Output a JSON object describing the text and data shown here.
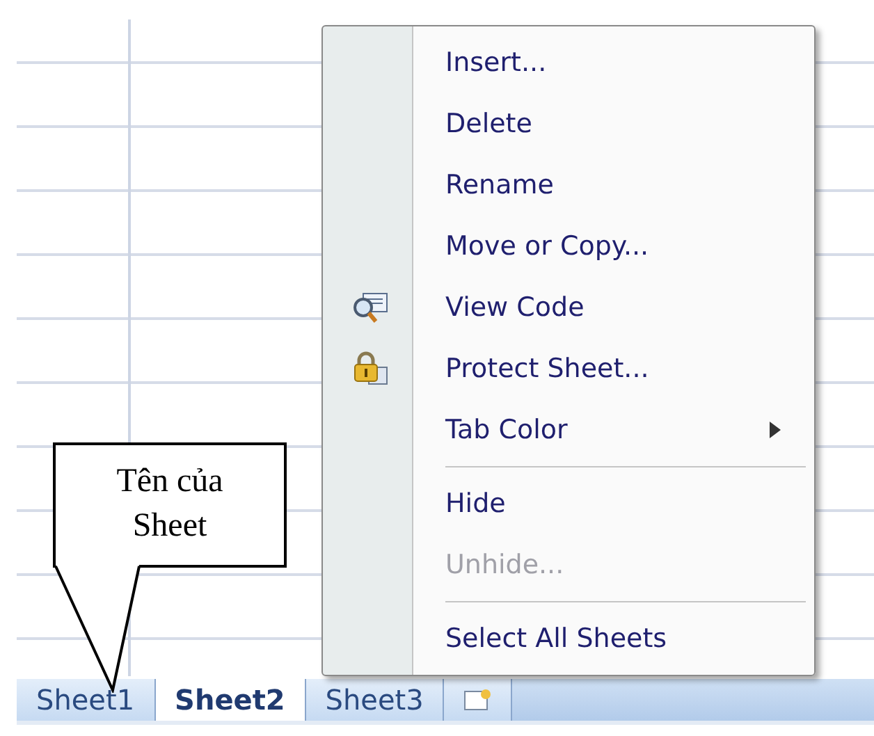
{
  "context_menu": {
    "items": [
      {
        "kind": "item",
        "label": "Insert...",
        "disabled": false
      },
      {
        "kind": "item",
        "label": "Delete",
        "disabled": false
      },
      {
        "kind": "item",
        "label": "Rename",
        "disabled": false
      },
      {
        "kind": "item",
        "label": "Move or Copy...",
        "disabled": false
      },
      {
        "kind": "code",
        "label": "View Code",
        "disabled": false
      },
      {
        "kind": "lock",
        "label": "Protect Sheet...",
        "disabled": false
      },
      {
        "kind": "submenu",
        "label": "Tab Color",
        "disabled": false
      },
      {
        "kind": "separator"
      },
      {
        "kind": "item",
        "label": "Hide",
        "disabled": false
      },
      {
        "kind": "item",
        "label": "Unhide...",
        "disabled": true
      },
      {
        "kind": "separator"
      },
      {
        "kind": "item",
        "label": "Select All Sheets",
        "disabled": false
      }
    ]
  },
  "callout": {
    "text": "Tên của Sheet"
  },
  "sheet_tabs": [
    {
      "label": "Sheet1",
      "selected": false
    },
    {
      "label": "Sheet2",
      "selected": true
    },
    {
      "label": "Sheet3",
      "selected": false
    }
  ]
}
